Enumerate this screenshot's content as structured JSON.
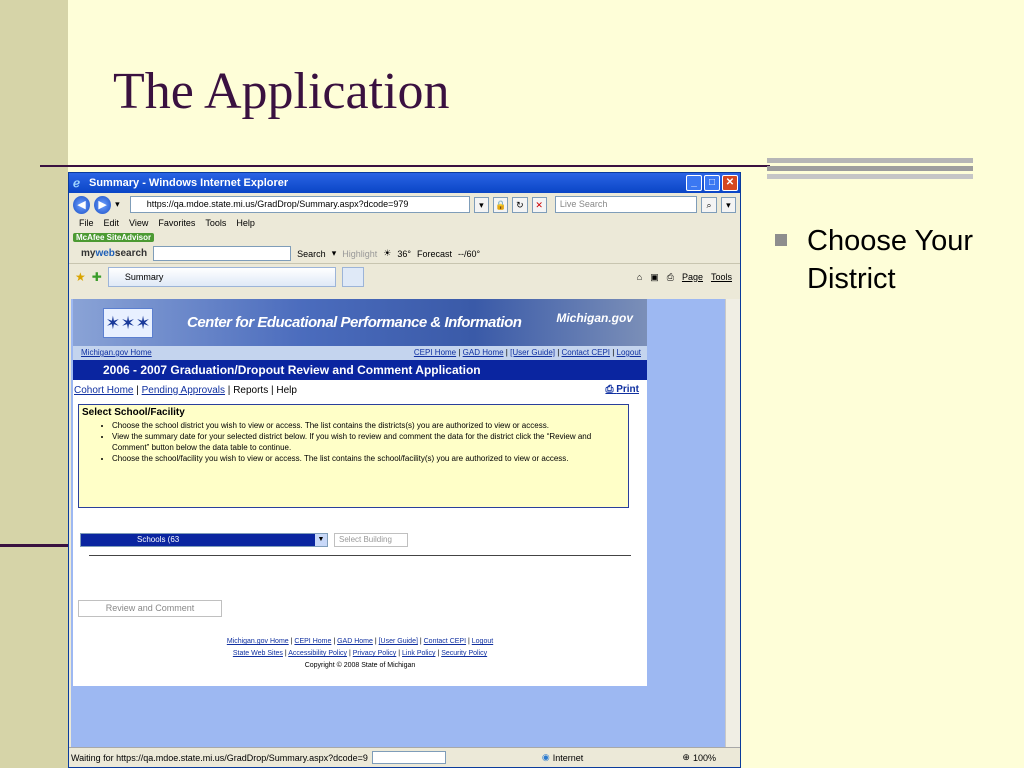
{
  "slide": {
    "title": "The Application",
    "bullet": "Choose Your District"
  },
  "window": {
    "title": "Summary - Windows Internet Explorer",
    "address": "https://qa.mdoe.state.mi.us/GradDrop/Summary.aspx?dcode=979",
    "search_placeholder": "Live Search",
    "menu": [
      "File",
      "Edit",
      "View",
      "Favorites",
      "Tools",
      "Help"
    ],
    "mcafee": "McAfee SiteAdvisor",
    "toolbar": {
      "brand_my": "my",
      "brand_web": "web",
      "brand_search": "search",
      "search_btn": "Search",
      "highlight": "Highlight",
      "temp": "36°",
      "forecast": "Forecast",
      "forecast_val": "--/60°"
    },
    "tab_title": "Summary",
    "cmd": [
      "Page",
      "Tools"
    ],
    "status_text": "Waiting for https://qa.mdoe.state.mi.us/GradDrop/Summary.aspx?dcode=9",
    "zone": "Internet",
    "zoom": "100%"
  },
  "page": {
    "banner_title": "Center for Educational Performance & Information",
    "banner_right": "Michigan.gov",
    "linkbar_left": "Michigan.gov Home",
    "linkbar_right": [
      "CEPI Home",
      "GAD Home",
      "[User Guide]",
      "Contact CEPI",
      "Logout"
    ],
    "app_title": "2006 - 2007 Graduation/Dropout Review and Comment Application",
    "subnav": [
      "Cohort Home",
      "Pending Approvals",
      "Reports",
      "Help"
    ],
    "print": "Print",
    "box_title": "Select School/Facility",
    "instructions": [
      "Choose the school district you wish to view or access. The list contains the districts(s) you are authorized to view or access.",
      "View the summary date for your selected district below. If you wish to review and comment the data for the district click the “Review and Comment” button below the data table to continue.",
      "Choose the school/facility you wish to view or access. The list contains the school/facility(s) you are authorized to view or access."
    ],
    "district_select": "Schools (63",
    "building_select": "Select Building",
    "review_button": "Review and Comment",
    "footer_line1": [
      "Michigan.gov Home",
      "CEPI Home",
      "GAD Home",
      "[User Guide]",
      "Contact CEPI",
      "Logout"
    ],
    "footer_line2": [
      "State Web Sites",
      "Accessibility Policy",
      "Privacy Policy",
      "Link Policy",
      "Security Policy"
    ],
    "copyright": "Copyright © 2008 State of Michigan"
  }
}
